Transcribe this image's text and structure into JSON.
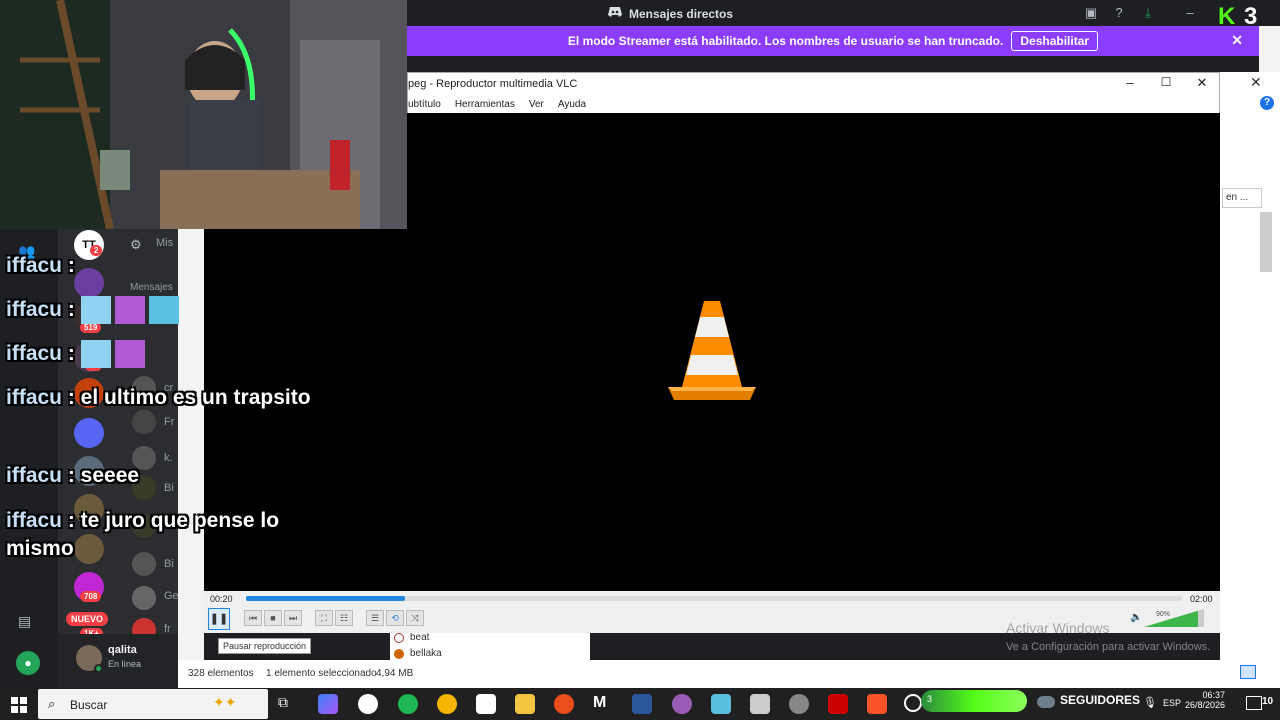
{
  "discord": {
    "title": "Mensajes directos",
    "banner_text": "El modo Streamer está habilitado. Los nombres de usuario se han truncado.",
    "banner_button": "Deshabilitar",
    "messages_header": "Mensajes",
    "channel_header": "Mis",
    "new_badge": "NUEVO",
    "badges": [
      "2",
      "519",
      "66",
      "708",
      "1K+"
    ],
    "member_texts": [
      "cr",
      "Fr",
      "k.",
      "Bi",
      "Bi",
      "Bi",
      "Ge",
      "fr"
    ],
    "user": {
      "name": "qalita",
      "status": "En línea"
    }
  },
  "kick_logo": {
    "letter": "K",
    "count": "3"
  },
  "vlc": {
    "title": "peg - Reproductor multimedia VLC",
    "menu": [
      "ubtítulo",
      "Herramientas",
      "Ver",
      "Ayuda"
    ],
    "time_elapsed": "00:20",
    "time_total": "02:00",
    "progress": 0.17,
    "volume_percent": "90%",
    "volume_level": 0.9,
    "tooltip": "Pausar reproducción"
  },
  "explorer": {
    "search_placeholder": "en ...",
    "status_count": "328 elementos",
    "status_selected": "1 elemento seleccionado",
    "status_size": "4,94 MB",
    "files": [
      "beat",
      "bellaka"
    ]
  },
  "watermark": {
    "line1": "Activar Windows",
    "line2": "Ve a Configuración para activar Windows."
  },
  "chat": [
    {
      "user": "iffacu",
      "text": ":"
    },
    {
      "user": "iffacu",
      "text": ":"
    },
    {
      "user": "iffacu",
      "text": ":"
    },
    {
      "user": "iffacu",
      "text": ": el ultimo es un trapsito"
    },
    {
      "user": "iffacu",
      "text": ": seeee"
    },
    {
      "user": "iffacu",
      "text": ": te juro que pense lo mismo"
    }
  ],
  "taskbar": {
    "search_label": "Buscar",
    "followers_count": "3",
    "followers_label": "SEGUIDORES",
    "lang": "ESP",
    "time": "06:37",
    "date": "26/8/2026",
    "notifications": "10"
  },
  "colors": {
    "kick_green": "#53fc18",
    "streamer_banner": "#8c3cfb",
    "vlc_blue": "#1f86e0"
  }
}
